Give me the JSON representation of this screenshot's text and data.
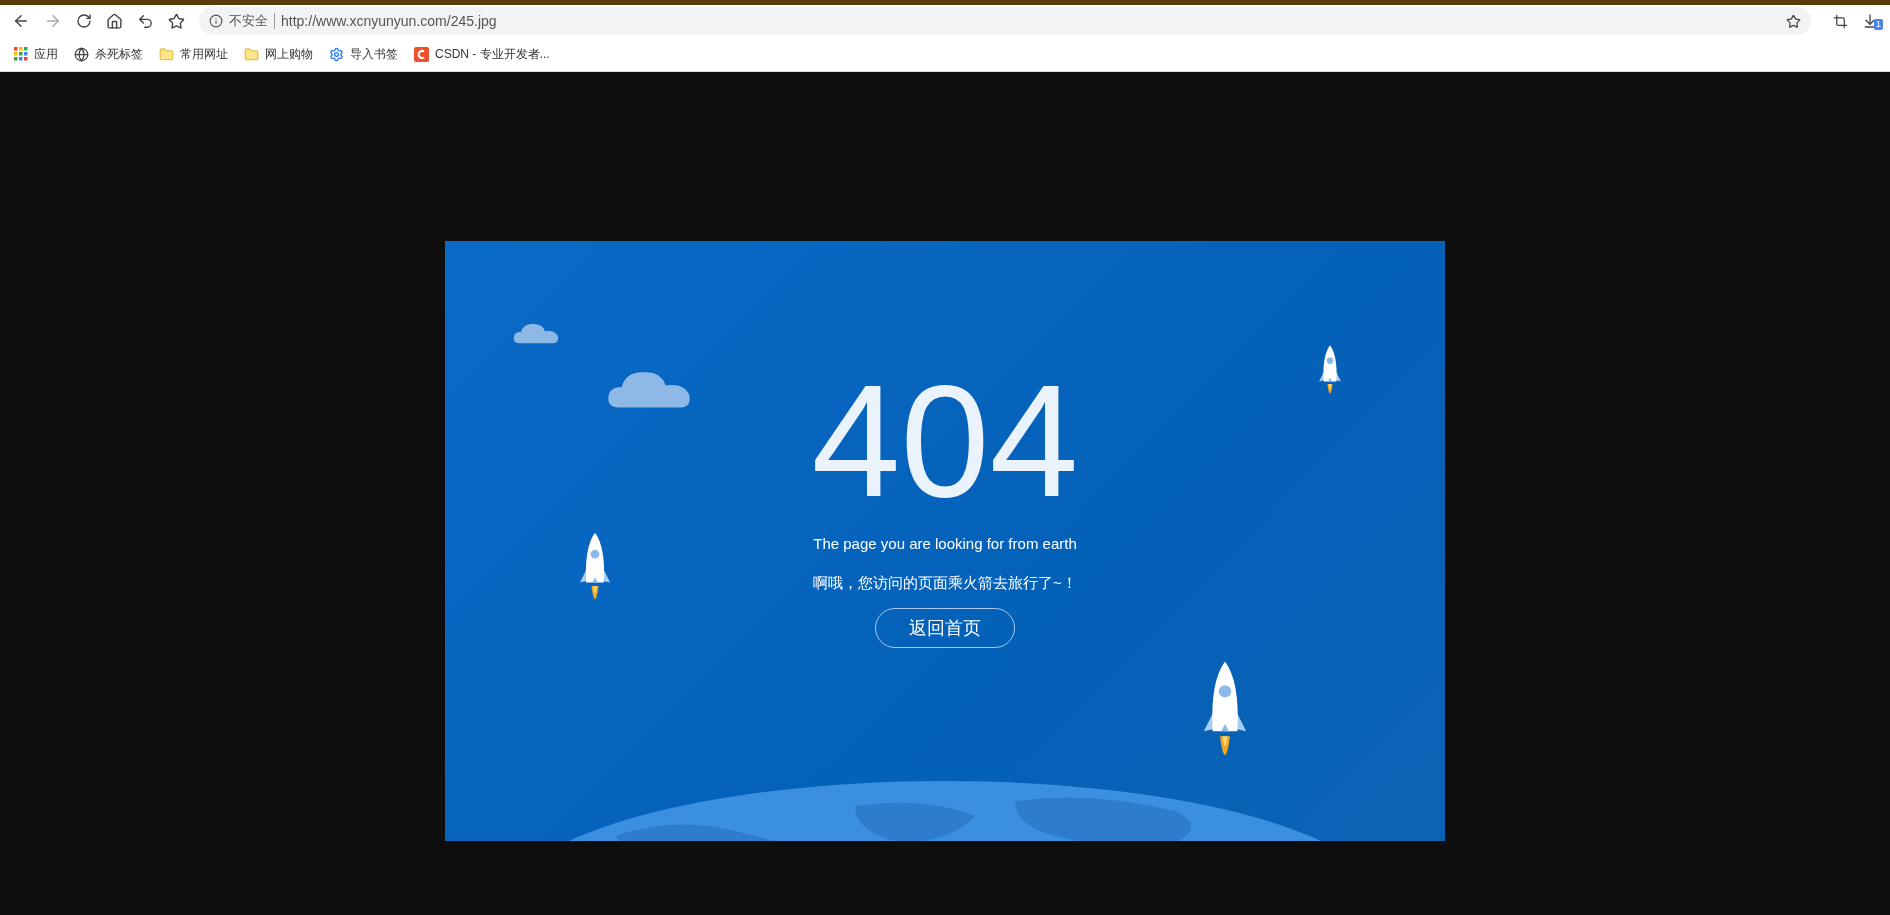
{
  "toolbar": {
    "security_label": "不安全",
    "url": "http://www.xcnyunyun.com/245.jpg",
    "downloads_badge": "1"
  },
  "bookmarks": [
    {
      "label": "应用",
      "kind": "apps"
    },
    {
      "label": "杀死标签",
      "kind": "globe"
    },
    {
      "label": "常用网址",
      "kind": "folder"
    },
    {
      "label": "网上购物",
      "kind": "folder"
    },
    {
      "label": "导入书签",
      "kind": "gear"
    },
    {
      "label": "CSDN - 专业开发者...",
      "kind": "csdn"
    }
  ],
  "image": {
    "code": "404",
    "subtitle": "The page you are looking for from earth",
    "message": "啊哦，您访问的页面乘火箭去旅行了~！",
    "home_button": "返回首页"
  }
}
